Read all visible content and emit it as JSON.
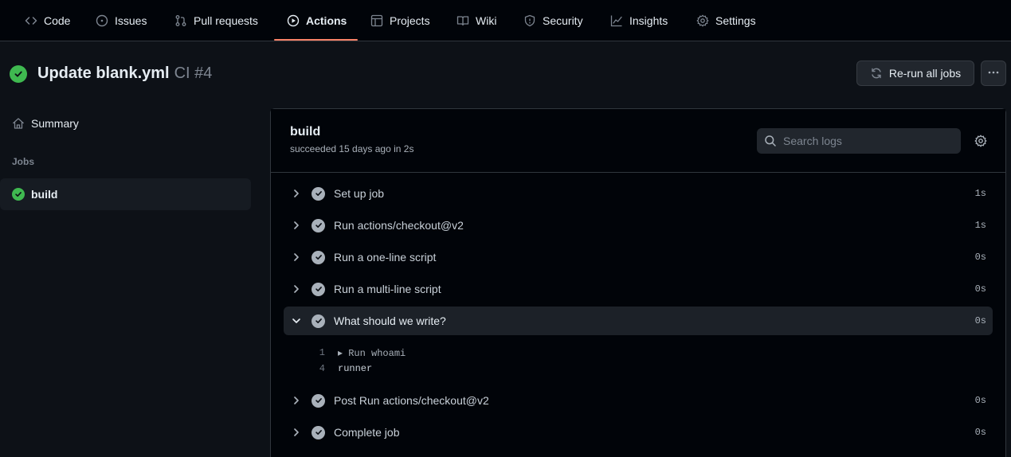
{
  "nav": {
    "tabs": [
      {
        "label": "Code",
        "icon": "code-icon"
      },
      {
        "label": "Issues",
        "icon": "issue-opened-icon"
      },
      {
        "label": "Pull requests",
        "icon": "git-pull-request-icon"
      },
      {
        "label": "Actions",
        "icon": "play-icon",
        "active": true
      },
      {
        "label": "Projects",
        "icon": "table-icon"
      },
      {
        "label": "Wiki",
        "icon": "book-icon"
      },
      {
        "label": "Security",
        "icon": "shield-icon"
      },
      {
        "label": "Insights",
        "icon": "graph-icon"
      },
      {
        "label": "Settings",
        "icon": "gear-icon"
      }
    ],
    "active_underline_color": "#f78166"
  },
  "run": {
    "title": "Update blank.yml",
    "workflow": "CI #4",
    "status": "success",
    "rerun_label": "Re-run all jobs"
  },
  "sidebar": {
    "summary_label": "Summary",
    "jobs_heading": "Jobs",
    "jobs": [
      {
        "label": "build",
        "status": "success"
      }
    ]
  },
  "job": {
    "name": "build",
    "status_text": "succeeded 15 days ago in 2s",
    "search_placeholder": "Search logs",
    "steps": [
      {
        "name": "Set up job",
        "duration": "1s"
      },
      {
        "name": "Run actions/checkout@v2",
        "duration": "1s"
      },
      {
        "name": "Run a one-line script",
        "duration": "0s"
      },
      {
        "name": "Run a multi-line script",
        "duration": "0s"
      },
      {
        "name": "What should we write?",
        "duration": "0s",
        "expanded": true
      },
      {
        "name": "Post Run actions/checkout@v2",
        "duration": "0s"
      },
      {
        "name": "Complete job",
        "duration": "0s"
      }
    ],
    "log_lines": [
      {
        "num": "1",
        "text": "▸ Run whoami"
      },
      {
        "num": "4",
        "text": "runner"
      }
    ]
  },
  "colors": {
    "success": "#3fb950",
    "background": "#0d1117",
    "panel": "#010409"
  }
}
